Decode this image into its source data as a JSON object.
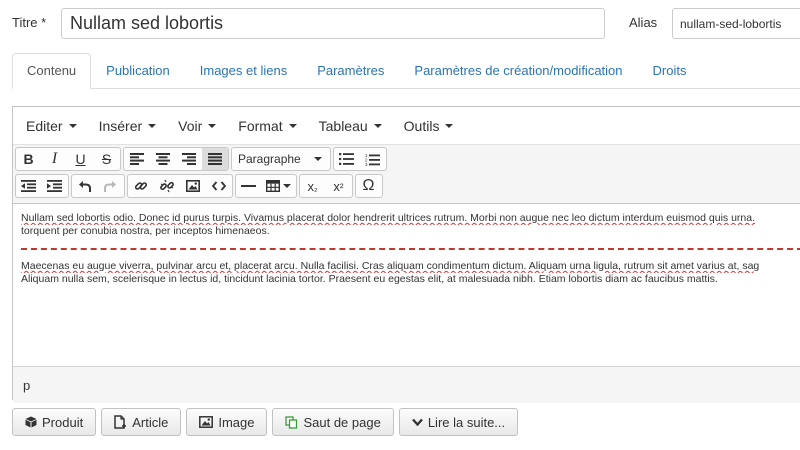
{
  "form": {
    "title_label": "Titre *",
    "title_value": "Nullam sed lobortis",
    "alias_label": "Alias",
    "alias_value": "nullam-sed-lobortis"
  },
  "tabs": [
    {
      "label": "Contenu",
      "active": true
    },
    {
      "label": "Publication"
    },
    {
      "label": "Images et liens"
    },
    {
      "label": "Paramètres"
    },
    {
      "label": "Paramètres de création/modification"
    },
    {
      "label": "Droits"
    }
  ],
  "menubar": [
    "Editer",
    "Insérer",
    "Voir",
    "Format",
    "Tableau",
    "Outils"
  ],
  "toolbar": {
    "bold": "B",
    "italic": "I",
    "underline": "U",
    "strike": "S",
    "format_select": "Paragraphe",
    "subscript": "x",
    "subscript_sub": "₂",
    "superscript": "x",
    "superscript_sup": "²",
    "omega": "Ω"
  },
  "content": {
    "p1_line1": "Nullam sed lobortis odio. Donec id purus turpis. Vivamus placerat dolor hendrerit ultrices rutrum. Morbi non augue nec leo dictum interdum euismod quis urna.",
    "p1_line2": "torquent per conubia nostra, per inceptos himenaeos.",
    "p2_line1": "Maecenas eu augue viverra, pulvinar arcu et, placerat arcu. Nulla facilisi. Cras aliquam condimentum dictum. Aliquam urna ligula, rutrum sit amet varius at, sag",
    "p2_line2": "Aliquam nulla sem, scelerisque in lectus id, tincidunt lacinia tortor. Praesent eu egestas elit, at malesuada nibh. Etiam lobortis diam ac faucibus mattis."
  },
  "statusbar": {
    "path": "p"
  },
  "buttons": {
    "produit": "Produit",
    "article": "Article",
    "image": "Image",
    "saut": "Saut de page",
    "lire": "Lire la suite..."
  },
  "colors": {
    "link": "#2a74b5",
    "pagebreak": "#c0392b"
  }
}
